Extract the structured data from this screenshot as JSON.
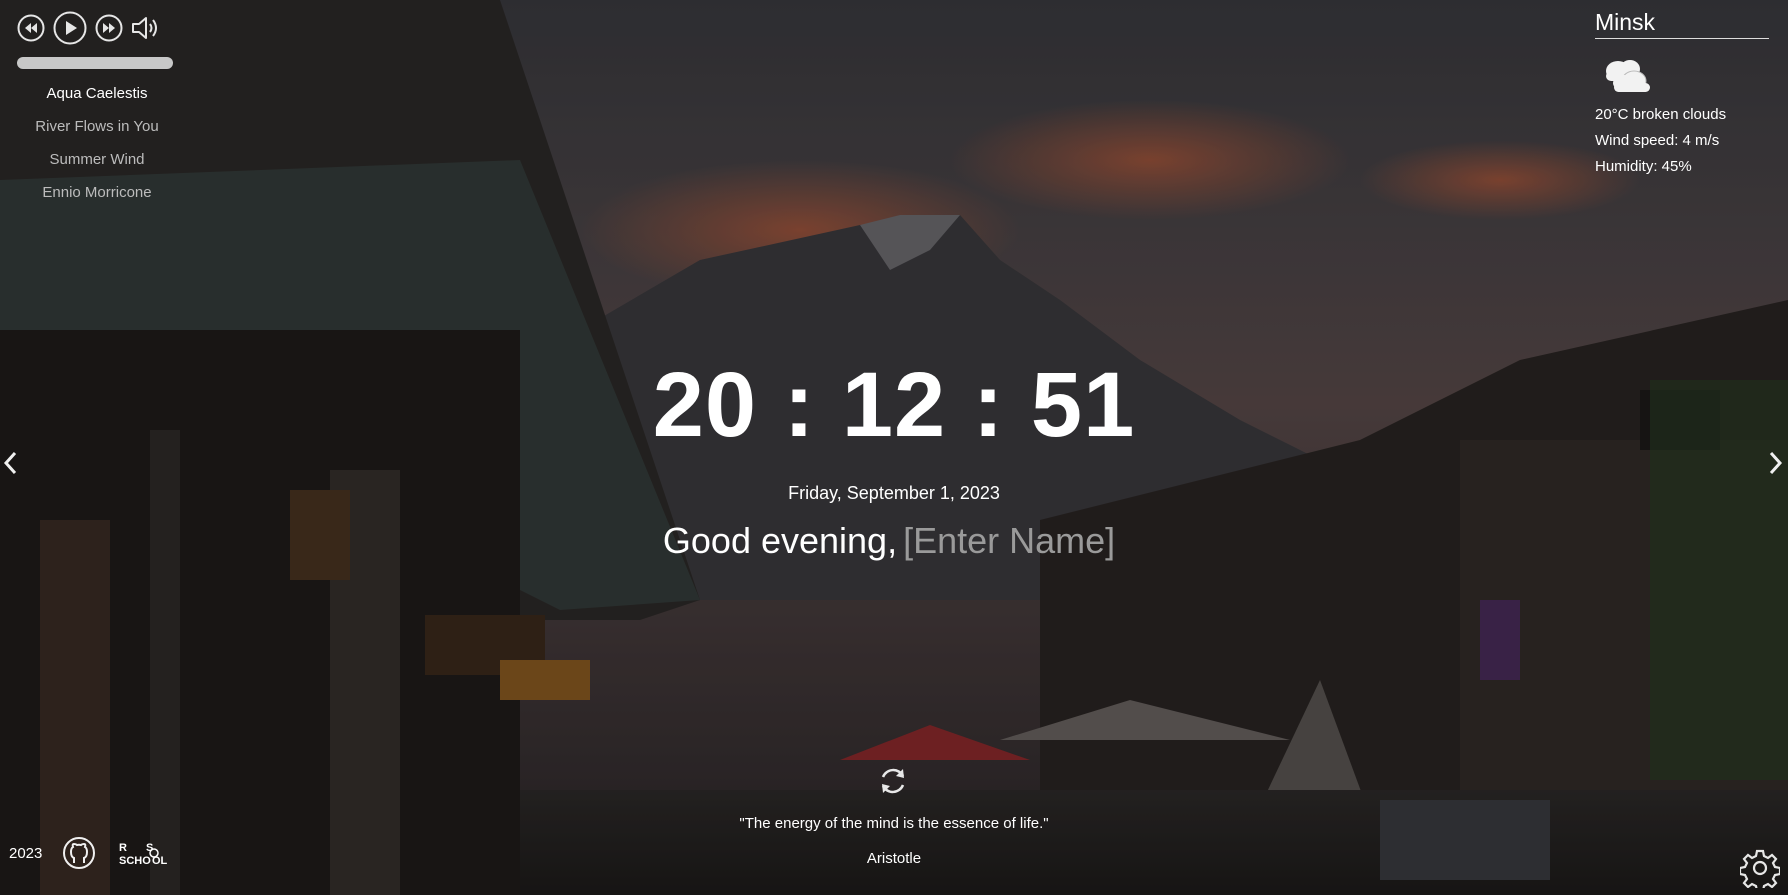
{
  "player": {
    "controls": [
      "prev-icon",
      "play-icon",
      "next-icon",
      "volume-icon"
    ],
    "tracks": [
      "Aqua Caelestis",
      "River Flows in You",
      "Summer Wind",
      "Ennio Morricone"
    ],
    "active_track": 0
  },
  "weather": {
    "city": "Minsk",
    "icon": "cloud-icon",
    "description": "20°C broken clouds",
    "wind": "Wind speed: 4 m/s",
    "humidity": "Humidity: 45%"
  },
  "time": "20:12:51",
  "date": "Friday, September 1, 2023",
  "greeting": {
    "text": "Good evening,",
    "name_placeholder": "[Enter Name]"
  },
  "quote": {
    "text": "\"The energy of the mind is the essence of life.\"",
    "author": "Aristotle"
  },
  "footer": {
    "year": "2023",
    "logo_text": "RS SCHOOL"
  },
  "colors": {
    "text": "#ffffff",
    "muted_track": "#bcbcbc",
    "progress": "#c8c8c8"
  }
}
